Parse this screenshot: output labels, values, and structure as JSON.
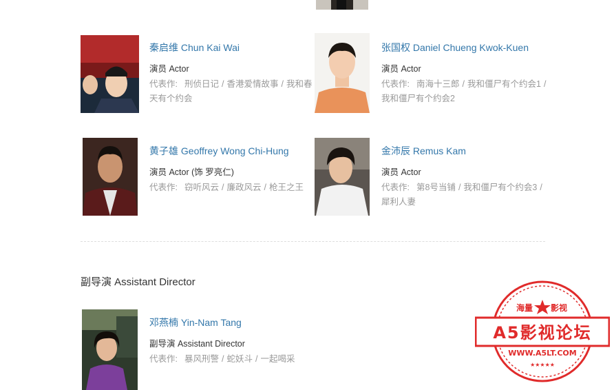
{
  "cast": [
    {
      "name": "秦启维 Chun Kai Wai",
      "role": "演员 Actor",
      "works_label": "代表作:",
      "works": [
        "刑侦日记",
        "香港爱情故事",
        "我和春天有个约会"
      ]
    },
    {
      "name": "张国权 Daniel Chueng Kwok-Kuen",
      "role": "演员 Actor",
      "works_label": "代表作:",
      "works": [
        "南海十三郎",
        "我和僵尸有个约会1",
        "我和僵尸有个约会2"
      ]
    },
    {
      "name": "黄子雄 Geoffrey Wong Chi-Hung",
      "role": "演员 Actor (饰 罗亮仁)",
      "works_label": "代表作:",
      "works": [
        "窃听风云",
        "廉政风云",
        "枪王之王"
      ]
    },
    {
      "name": "金沛辰 Remus Kam",
      "role": "演员 Actor",
      "works_label": "代表作:",
      "works": [
        "第8号当铺",
        "我和僵尸有个约会3",
        "犀利人妻"
      ]
    }
  ],
  "section": {
    "title": "副导演 Assistant Director"
  },
  "crew": [
    {
      "name": "邓燕楠 Yin-Nam Tang",
      "role": "副导演 Assistant Director",
      "works_label": "代表作:",
      "works": [
        "暴风刑警",
        "蛇妖斗",
        "一起喝采"
      ]
    }
  ],
  "watermark": {
    "top_left": "海量",
    "top_right": "影视",
    "main": "A5影视论坛",
    "url": "WWW.A5LT.COM",
    "color": "#e02b2b"
  }
}
